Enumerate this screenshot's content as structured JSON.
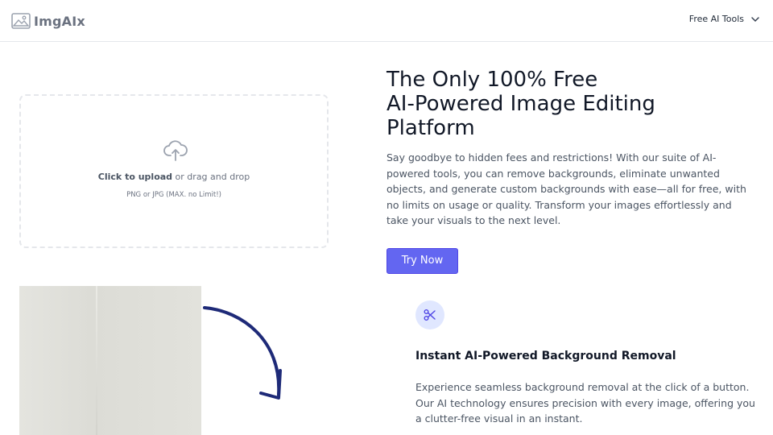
{
  "header": {
    "logo_text": "ImgAIx",
    "nav_tools_label": "Free AI Tools"
  },
  "upload": {
    "click_label": "Click to upload",
    "drag_label": " or drag and drop",
    "formats": "PNG or JPG (MAX. no Limit!)"
  },
  "hero": {
    "title_line1": "The Only 100% Free",
    "title_line2": "AI-Powered Image Editing",
    "title_line3": "Platform",
    "description": "Say goodbye to hidden fees and restrictions! With our suite of AI-powered tools, you can remove backgrounds, eliminate unwanted objects, and generate custom backgrounds with ease—all for free, with no limits on usage or quality. Transform your images effortlessly and take your visuals to the next level.",
    "cta_label": "Try Now"
  },
  "feature": {
    "icon": "scissors-icon",
    "title": "Instant AI-Powered Background Removal",
    "description": "Experience seamless background removal at the click of a button. Our AI technology ensures precision with every image, offering you a clutter-free visual in an instant."
  },
  "colors": {
    "accent": "#6366f1",
    "arrow": "#1e2a78",
    "feature_icon_bg": "#e0e7ff"
  }
}
